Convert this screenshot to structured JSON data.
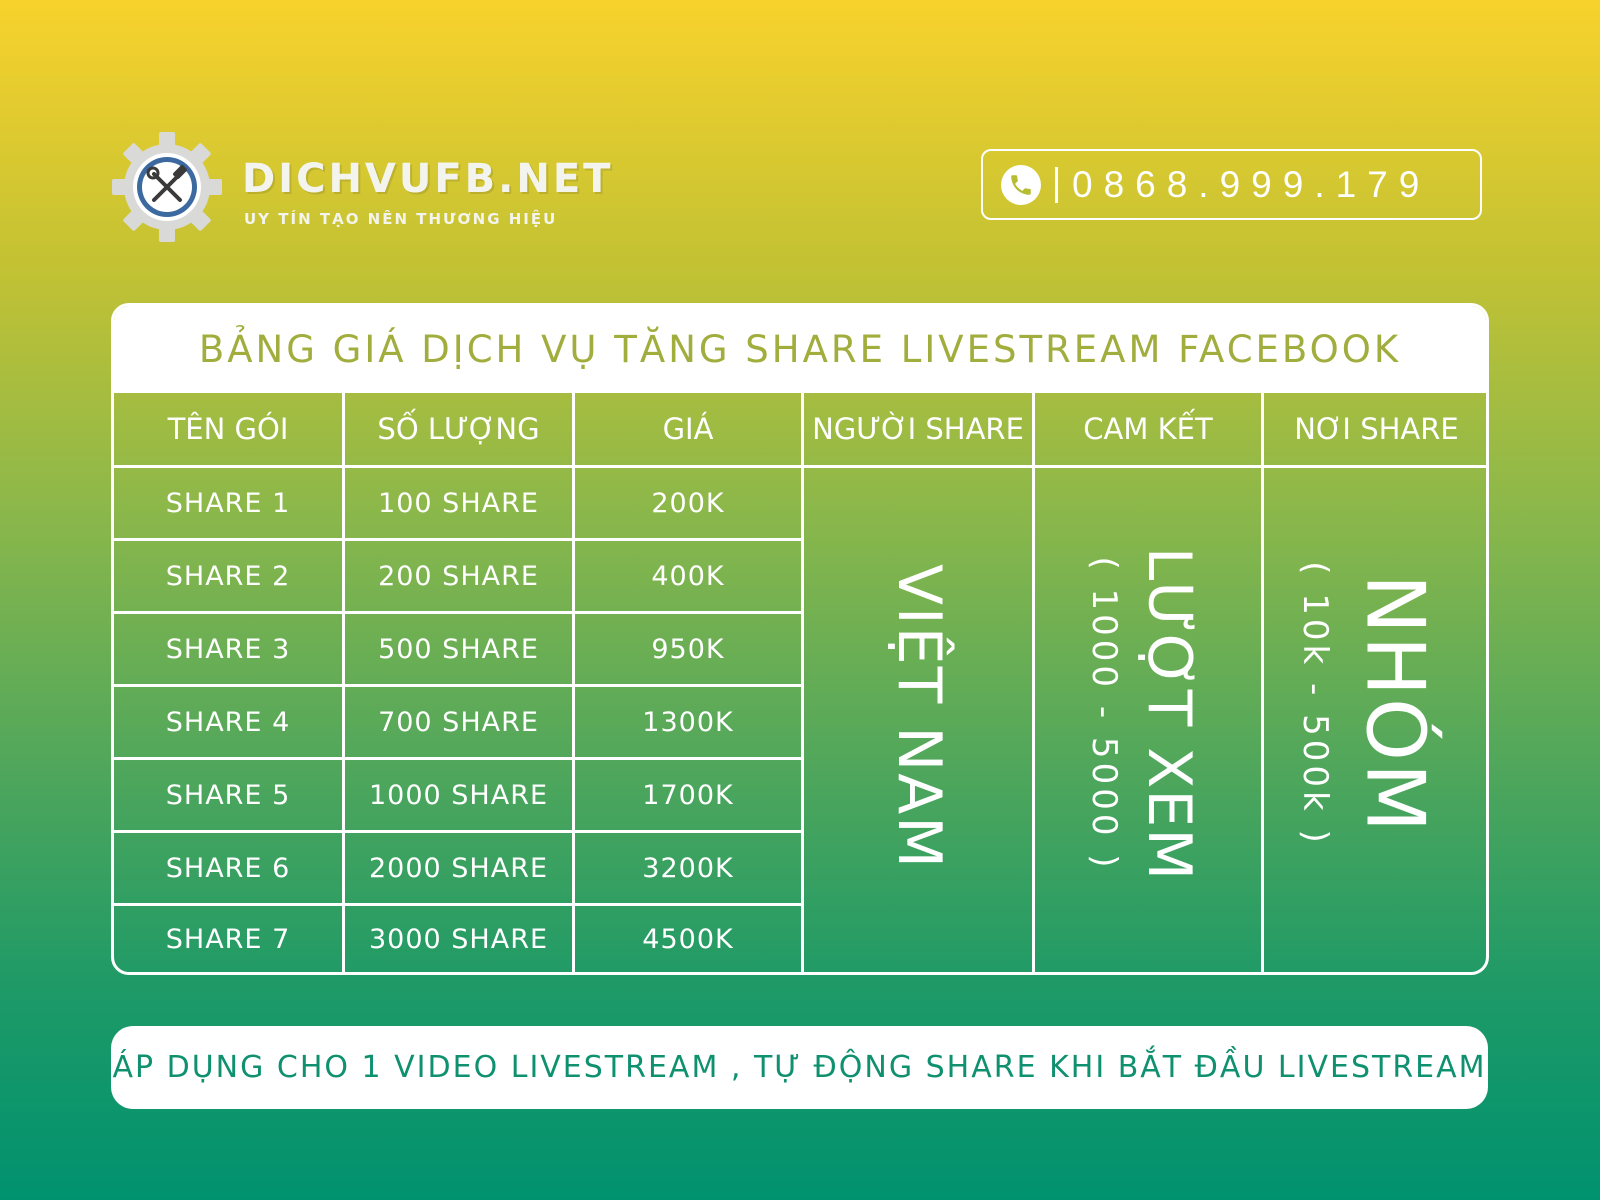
{
  "brand": {
    "name": "DICHVUFB.NET",
    "slogan": "UY TÍN TẠO NÊN THƯƠNG HIỆU",
    "logo_icon": "gear-wrench-hammer-icon"
  },
  "contact": {
    "phone_icon": "phone-icon",
    "phone": "0868.999.179"
  },
  "price_table": {
    "title": "BẢNG GIÁ DỊCH VỤ TĂNG SHARE LIVESTREAM FACEBOOK",
    "columns": [
      "TÊN GÓI",
      "SỐ LƯỢNG",
      "GIÁ",
      "NGƯỜI SHARE",
      "CAM KẾT",
      "NƠI SHARE"
    ],
    "rows": [
      {
        "package": "SHARE 1",
        "quantity": "100 SHARE",
        "price": "200K"
      },
      {
        "package": "SHARE 2",
        "quantity": "200 SHARE",
        "price": "400K"
      },
      {
        "package": "SHARE 3",
        "quantity": "500 SHARE",
        "price": "950K"
      },
      {
        "package": "SHARE 4",
        "quantity": "700 SHARE",
        "price": "1300K"
      },
      {
        "package": "SHARE 5",
        "quantity": "1000 SHARE",
        "price": "1700K"
      },
      {
        "package": "SHARE 6",
        "quantity": "2000 SHARE",
        "price": "3200K"
      },
      {
        "package": "SHARE 7",
        "quantity": "3000 SHARE",
        "price": "4500K"
      }
    ],
    "sharer": "VIỆT NAM",
    "commitment": {
      "main": "LƯỢT XEM",
      "range": "( 1000 - 5000 )"
    },
    "share_place": {
      "main": "NHÓM",
      "range": "( 10k - 500k )"
    }
  },
  "note": "ÁP DỤNG CHO 1 VIDEO LIVESTREAM , TỰ ĐỘNG SHARE KHI BẮT ĐẦU LIVESTREAM",
  "colors": {
    "title_text": "#a1ad3c",
    "note_text": "#0f9170",
    "gradient_top": "#f8d22c",
    "gradient_bottom": "#00926f"
  }
}
